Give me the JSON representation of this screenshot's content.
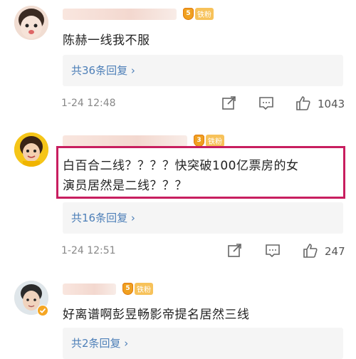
{
  "comments": [
    {
      "badge": "铁粉",
      "badge_level": "5",
      "text": "陈赫一线我不服",
      "reply_link": "共36条回复 ›",
      "time": "1-24 12:48",
      "likes": "1043"
    },
    {
      "badge": "铁粉",
      "badge_level": "3",
      "text_line1": "白百合二线？？？？快突破100亿票房的女",
      "text_line2": "演员居然是二线？？？",
      "reply_link": "共16条回复 ›",
      "time": "1-24 12:51",
      "likes": "247"
    },
    {
      "badge": "铁粉",
      "badge_level": "5",
      "text": "好离谱啊彭昱畅影帝提名居然三线",
      "reply_link": "共2条回复 ›"
    }
  ],
  "colors": {
    "link": "#4d7fb8",
    "highlight_border": "#c81e5f",
    "reply_bg": "#f5f5f5"
  },
  "icons": [
    "share-icon",
    "comment-icon",
    "like-icon",
    "verified-badge-icon",
    "iron-fan-medal-icon"
  ]
}
